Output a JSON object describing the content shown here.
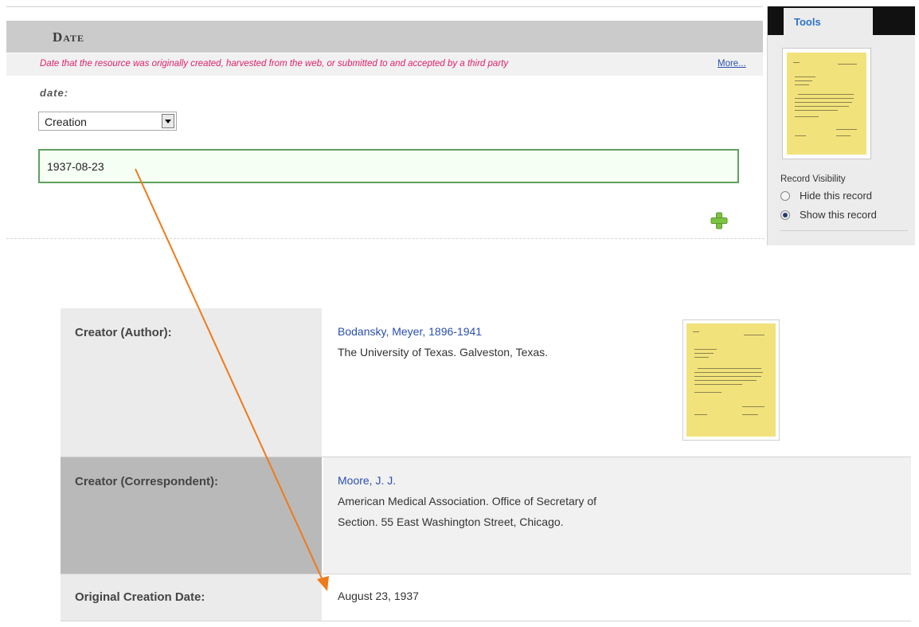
{
  "date_section": {
    "title": "Date",
    "description": "Date that the resource was originally created, harvested from the web, or submitted to and accepted by a third party",
    "more_link": "More...",
    "field_label": "date:",
    "type_select": {
      "selected": "Creation"
    },
    "date_value": "1937-08-23",
    "add_icon": "plus-icon"
  },
  "tools_panel": {
    "tab_label": "Tools",
    "visibility": {
      "label": "Record Visibility",
      "options": [
        {
          "label": "Hide this record",
          "selected": false
        },
        {
          "label": "Show this record",
          "selected": true
        }
      ]
    }
  },
  "record": {
    "rows": [
      {
        "label": "Creator (Author):",
        "name": "Bodansky, Meyer, 1896-1941",
        "info": "The University of Texas. Galveston, Texas."
      },
      {
        "label": "Creator (Correspondent):",
        "name": "Moore, J. J.",
        "info_line1": "American Medical Association. Office of Secretary of",
        "info_line2": "Section. 55 East Washington Street, Chicago."
      },
      {
        "label": "Original Creation Date:",
        "value": "August 23, 1937"
      }
    ]
  },
  "colors": {
    "description_text": "#e0206a",
    "link": "#2a4fb0",
    "arrow": "#ef7a1a",
    "add_icon": "#7dc242",
    "input_border": "#5fa05f",
    "thumbnail_paper": "#f2e27b"
  }
}
